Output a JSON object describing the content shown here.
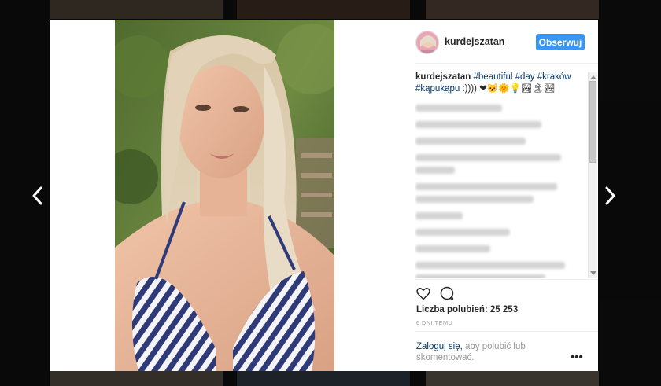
{
  "post": {
    "username": "kurdejszatan",
    "follow_label": "Obserwuj",
    "caption_author": "kurdejszatan",
    "caption_tags": [
      "#beautiful",
      "#day",
      "#kraków",
      "#kąpukąpu"
    ],
    "caption_suffix": ":)))) ❤😺🌞💡🏞🏝🏞",
    "likes_label": "Liczba polubień: 25 253",
    "time_label": "6 DNI TEMU",
    "login_link": "Zaloguj się,",
    "login_rest": "aby polubić lub skomentować.",
    "more_label": "•••"
  },
  "icons": {
    "prev": "chevron-left-icon",
    "next": "chevron-right-icon",
    "like": "heart-icon",
    "comment": "comment-bubble-icon",
    "more": "more-dots-icon"
  },
  "colors": {
    "follow_button": "#3897f0",
    "link": "#003569",
    "secondary_text": "#999999"
  }
}
